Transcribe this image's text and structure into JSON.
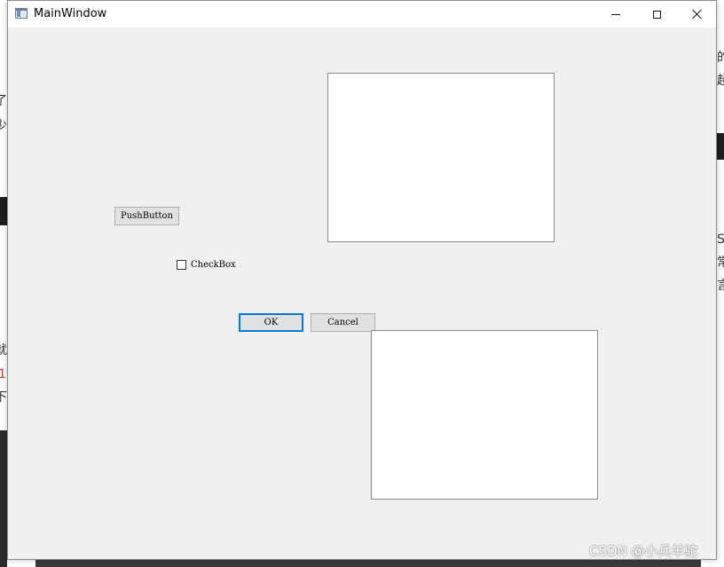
{
  "window": {
    "title": "MainWindow",
    "controls": {
      "minimize_icon": "minimize-icon",
      "maximize_icon": "maximize-icon",
      "close_icon": "close-icon"
    }
  },
  "widgets": {
    "push_button": "PushButton",
    "checkbox": {
      "label": "CheckBox",
      "checked": false
    },
    "ok_button": "OK",
    "cancel_button": "Cancel"
  },
  "background": {
    "left_fragments": [
      "了",
      "少",
      "就",
      "1",
      "下"
    ],
    "right_fragments": [
      "的",
      "超",
      "S",
      "常",
      "言"
    ]
  },
  "watermark": "CSDN @小兵羊驼",
  "colors": {
    "window_bg": "#f0f0f0",
    "titlebar_bg": "#ffffff",
    "focus_accent": "#0078d7",
    "button_bg": "#e1e1e1"
  }
}
